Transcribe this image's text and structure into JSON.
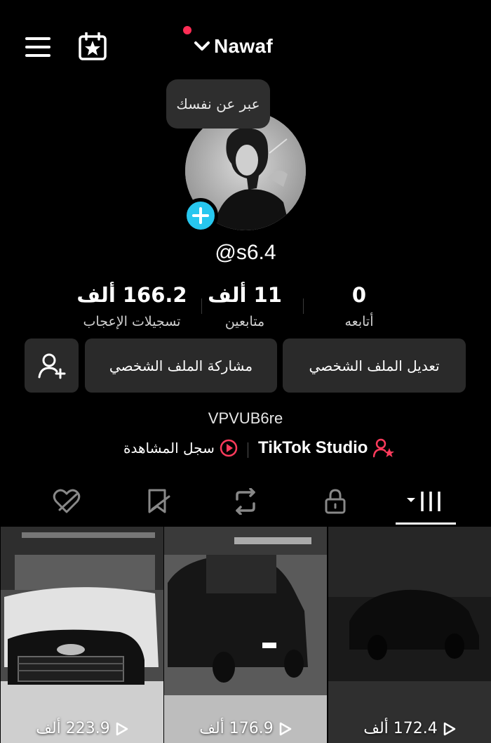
{
  "header": {
    "username": "Nawaf",
    "notification_dot_color": "#ff2d55",
    "menu_icon": "hamburger-menu-icon",
    "calendar_icon": "calendar-star-icon"
  },
  "profile": {
    "bubble_text": "عبر عن نفسك",
    "handle": "@s6.4",
    "bio": "VPVUB6re",
    "add_avatar_color": "#27c7ef"
  },
  "stats": {
    "likes": {
      "value": "166.2 ألف",
      "label": "تسجيلات الإعجاب"
    },
    "followers": {
      "value": "11 ألف",
      "label": "متابعين"
    },
    "following": {
      "value": "0",
      "label": "أتابعه"
    }
  },
  "actions": {
    "edit_profile": "تعديل الملف الشخصي",
    "share_profile": "مشاركة الملف الشخصي",
    "add_friend_icon": "add-friend-icon"
  },
  "links": {
    "studio": "TikTok Studio",
    "history": "سجل المشاهدة"
  },
  "tabs": [
    "videos-grid",
    "private-lock",
    "reposts",
    "favorites",
    "liked"
  ],
  "videos": [
    {
      "views": "223.9 ألف"
    },
    {
      "views": "176.9 ألف"
    },
    {
      "views": "172.4 ألف"
    }
  ]
}
